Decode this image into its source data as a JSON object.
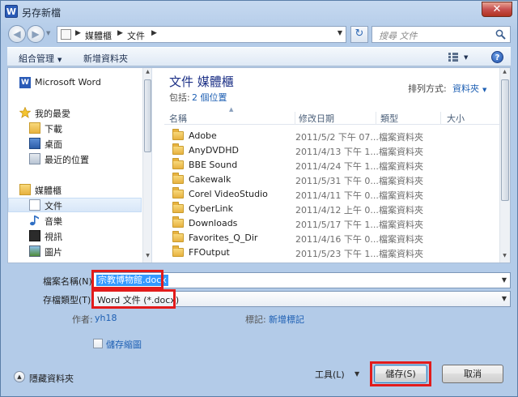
{
  "window": {
    "title": "另存新檔",
    "app_icon": "W",
    "close_glyph": "✕"
  },
  "nav": {
    "back_glyph": "◀",
    "forward_glyph": "▶",
    "history_glyph": "▼",
    "breadcrumb": [
      "媒體櫃",
      "文件"
    ],
    "crumb_sep": "▶",
    "refresh_glyph": "↻",
    "search_placeholder": "搜尋 文件"
  },
  "toolbar": {
    "organize": "組合管理",
    "new_folder": "新增資料夾",
    "help": "?"
  },
  "sidebar": {
    "items": [
      {
        "label": "Microsoft Word",
        "icon": "word-icon"
      },
      {
        "label": "我的最愛",
        "icon": "favorites-star-icon"
      },
      {
        "label": "下載",
        "icon": "downloads-icon"
      },
      {
        "label": "桌面",
        "icon": "desktop-icon"
      },
      {
        "label": "最近的位置",
        "icon": "recent-places-icon"
      },
      {
        "label": "媒體櫃",
        "icon": "libraries-icon"
      },
      {
        "label": "文件",
        "icon": "documents-icon",
        "selected": true
      },
      {
        "label": "音樂",
        "icon": "music-icon"
      },
      {
        "label": "視訊",
        "icon": "videos-icon"
      },
      {
        "label": "圖片",
        "icon": "pictures-icon"
      }
    ]
  },
  "library": {
    "title": "文件 媒體櫃",
    "sub_label": "包括:",
    "sub_link": "2 個位置",
    "arrange_label": "排列方式:",
    "arrange_value": "資料夾"
  },
  "columns": {
    "name": "名稱",
    "date": "修改日期",
    "type": "類型",
    "size": "大小"
  },
  "files": [
    {
      "name": "Adobe",
      "date": "2011/5/2 下午 07...",
      "type": "檔案資料夾"
    },
    {
      "name": "AnyDVDHD",
      "date": "2011/4/13 下午 1...",
      "type": "檔案資料夾"
    },
    {
      "name": "BBE Sound",
      "date": "2011/4/24 下午 1...",
      "type": "檔案資料夾"
    },
    {
      "name": "Cakewalk",
      "date": "2011/5/31 下午 0...",
      "type": "檔案資料夾"
    },
    {
      "name": "Corel VideoStudio",
      "date": "2011/4/11 下午 0...",
      "type": "檔案資料夾"
    },
    {
      "name": "CyberLink",
      "date": "2011/4/12 上午 0...",
      "type": "檔案資料夾"
    },
    {
      "name": "Downloads",
      "date": "2011/5/17 下午 1...",
      "type": "檔案資料夾"
    },
    {
      "name": "Favorites_Q_Dir",
      "date": "2011/4/16 下午 0...",
      "type": "檔案資料夾"
    },
    {
      "name": "FFOutput",
      "date": "2011/5/23 下午 1...",
      "type": "檔案資料夾"
    }
  ],
  "form": {
    "filename_label": "檔案名稱(N):",
    "filename_value": "宗教博物館.docx",
    "filetype_label": "存檔類型(T):",
    "filetype_value": "Word 文件 (*.docx)",
    "author_label": "作者:",
    "author_value": "yh18",
    "tags_label": "標記:",
    "tags_value": "新增標記",
    "thumbnail_label": "儲存縮圖"
  },
  "footer": {
    "hide_folders": "隱藏資料夾",
    "tools": "工具(L)",
    "save": "儲存(S)",
    "cancel": "取消"
  },
  "colors": {
    "highlight_red": "#e21b1b",
    "selection_blue": "#3399ff",
    "link_blue": "#1d5fb3"
  }
}
